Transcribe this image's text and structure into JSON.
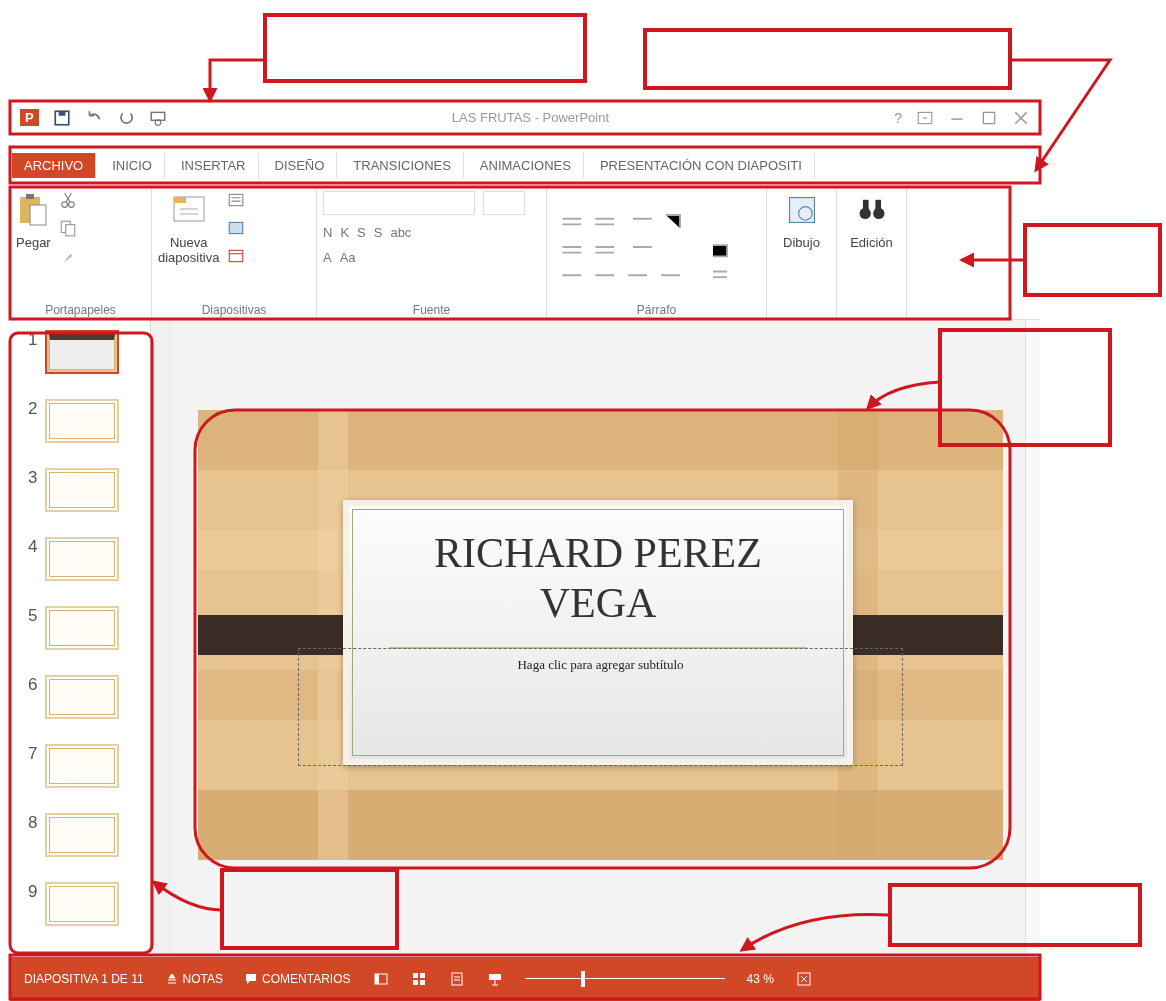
{
  "window": {
    "app_badge": "P",
    "title": "LAS FRUTAS - PowerPoint",
    "help": "?"
  },
  "tabs": [
    {
      "label": "ARCHIVO",
      "selected": true
    },
    {
      "label": "INICIO",
      "selected": false
    },
    {
      "label": "INSERTAR",
      "selected": false
    },
    {
      "label": "DISEÑO",
      "selected": false
    },
    {
      "label": "TRANSICIONES",
      "selected": false
    },
    {
      "label": "ANIMACIONES",
      "selected": false
    },
    {
      "label": "PRESENTACIÓN CON DIAPOSITI",
      "selected": false
    }
  ],
  "ribbon": {
    "paste": "Pegar",
    "new_slide": [
      "Nueva",
      "diapositiva"
    ],
    "font_buttons": [
      "N",
      "K",
      "S",
      "S",
      "abc"
    ],
    "font_size_buttons": [
      "A",
      "Aa"
    ],
    "draw": "Dibujo",
    "edit": "Edición",
    "groups": [
      "Portapapeles",
      "Diapositivas",
      "Fuente",
      "Párrafo"
    ]
  },
  "thumbnails": [
    {
      "number": "1",
      "selected": true
    },
    {
      "number": "2",
      "selected": false
    },
    {
      "number": "3",
      "selected": false
    },
    {
      "number": "4",
      "selected": false
    },
    {
      "number": "5",
      "selected": false
    },
    {
      "number": "6",
      "selected": false
    },
    {
      "number": "7",
      "selected": false
    },
    {
      "number": "8",
      "selected": false
    },
    {
      "number": "9",
      "selected": false
    }
  ],
  "slide": {
    "title": [
      "RICHARD PEREZ",
      "VEGA"
    ],
    "subtitle_placeholder": "Haga clic para agregar subtítulo"
  },
  "status_bar": {
    "position": "DIAPOSITIVA 1 DE 11",
    "notes": "NOTAS",
    "comments": "COMENTARIOS",
    "zoom": {
      "level": 0.28
    },
    "zoom_reading": "43 %"
  }
}
